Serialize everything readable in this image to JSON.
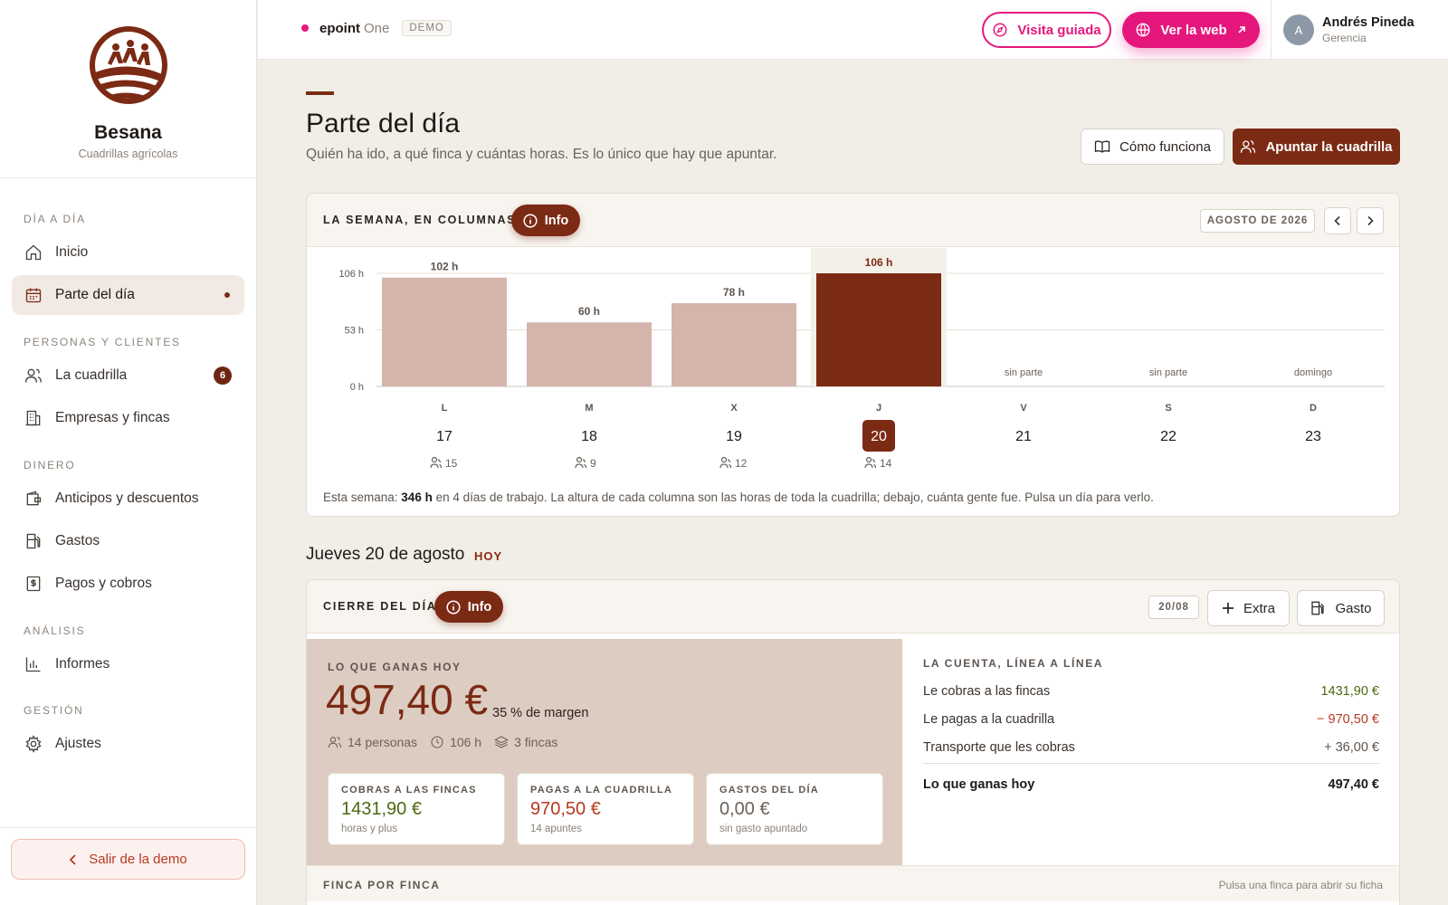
{
  "brand": {
    "name": "Besana",
    "subtitle": "Cuadrillas agrícolas"
  },
  "sidebar": {
    "sections": [
      {
        "label": "DÍA A DÍA"
      },
      {
        "label": "PERSONAS Y CLIENTES"
      },
      {
        "label": "DINERO"
      },
      {
        "label": "ANÁLISIS"
      },
      {
        "label": "GESTIÓN"
      }
    ],
    "items": [
      {
        "label": "Inicio",
        "icon": "home-icon"
      },
      {
        "label": "Parte del día",
        "icon": "calendar-icon",
        "active": true
      },
      {
        "label": "La cuadrilla",
        "icon": "users-icon",
        "badge": "6"
      },
      {
        "label": "Empresas y fincas",
        "icon": "building-icon"
      },
      {
        "label": "Anticipos y descuentos",
        "icon": "wallet-icon"
      },
      {
        "label": "Gastos",
        "icon": "fuel-icon"
      },
      {
        "label": "Pagos y cobros",
        "icon": "dollar-doc-icon"
      },
      {
        "label": "Informes",
        "icon": "bar-chart-icon"
      },
      {
        "label": "Ajustes",
        "icon": "gear-icon"
      }
    ],
    "exit_label": "Salir de la demo"
  },
  "topbar": {
    "product": "epoint",
    "product_suffix": "One",
    "demo": "DEMO",
    "guided_label": "Visita guiada",
    "web_label": "Ver la web",
    "user_initial": "A",
    "user_name": "Andrés Pineda",
    "user_role": "Gerencia"
  },
  "page": {
    "title": "Parte del día",
    "subtitle": "Quién ha ido, a qué finca y cuántas horas. Es lo único que hay que apuntar.",
    "how_label": "Cómo funciona",
    "crew_label": "Apuntar la cuadrilla"
  },
  "week": {
    "title": "LA SEMANA, EN COLUMNAS",
    "info_label": "Info",
    "month": "AGOSTO DE 2026",
    "note_prefix": "Esta semana: ",
    "note_hours": "346 h",
    "note_rest": " en 4 días de trabajo. La altura de cada columna son las horas de toda la cuadrilla; debajo, cuánta gente fue. Pulsa un día para verlo."
  },
  "chart_data": {
    "type": "bar",
    "categories": [
      "L",
      "M",
      "X",
      "J",
      "V",
      "S",
      "D"
    ],
    "dates": [
      "17",
      "18",
      "19",
      "20",
      "21",
      "22",
      "23"
    ],
    "values": [
      102,
      60,
      78,
      106,
      null,
      null,
      null
    ],
    "value_labels": [
      "102 h",
      "60 h",
      "78 h",
      "106 h",
      "",
      "",
      ""
    ],
    "empty_labels": [
      "",
      "",
      "",
      "",
      "sin parte",
      "sin parte",
      "domingo"
    ],
    "people": [
      "15",
      "9",
      "12",
      "14",
      "",
      "",
      ""
    ],
    "yticks": [
      "0 h",
      "53 h",
      "106 h"
    ],
    "ylim": [
      0,
      106
    ],
    "selected_index": 3,
    "colors": {
      "bar": "#d4b5ac",
      "selected": "#7b2a14"
    }
  },
  "day": {
    "heading": "Jueves 20 de agosto",
    "today": "HOY",
    "close_title": "CIERRE DEL DÍA",
    "info_label": "Info",
    "date_chip": "20/08",
    "extra_label": "Extra",
    "expense_label": "Gasto",
    "earn_label": "LO QUE GANAS HOY",
    "earn_value": "497,40 €",
    "margin": "35 % de margen",
    "people": "14 personas",
    "hours": "106 h",
    "farms": "3 fincas",
    "cards": [
      {
        "label": "COBRAS A LAS FINCAS",
        "value": "1431,90 €",
        "sub": "horas y plus",
        "color": "#4a6a12"
      },
      {
        "label": "PAGAS A LA CUADRILLA",
        "value": "970,50 €",
        "sub": "14 apuntes",
        "color": "#b5391f"
      },
      {
        "label": "GASTOS DEL DÍA",
        "value": "0,00 €",
        "sub": "sin gasto apuntado",
        "color": "#6b625a"
      }
    ],
    "ledger_title": "LA CUENTA, LÍNEA A LÍNEA",
    "ledger": [
      {
        "label": "Le cobras a las fincas",
        "value": "1431,90 €",
        "color": "#4a6a12"
      },
      {
        "label": "Le pagas a la cuadrilla",
        "value": "− 970,50 €",
        "color": "#b5391f"
      },
      {
        "label": "Transporte que les cobras",
        "value": "+ 36,00 €",
        "color": "#5e554e"
      }
    ],
    "total_label": "Lo que ganas hoy",
    "total_value": "497,40 €",
    "farm_title": "FINCA POR FINCA",
    "farm_hint": "Pulsa una finca para abrir su ficha"
  }
}
